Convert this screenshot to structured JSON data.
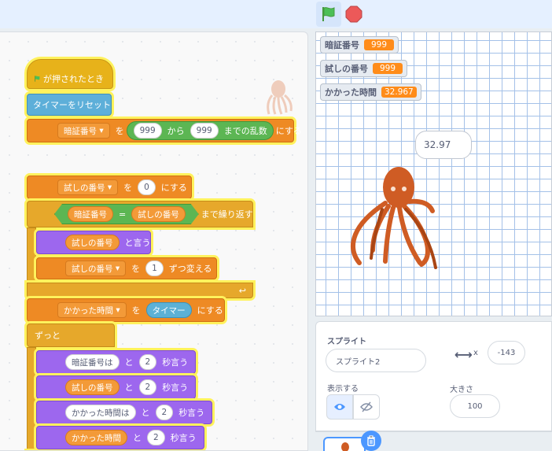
{
  "toolbar": {
    "flag_icon": "green-flag-icon",
    "stop_icon": "stop-icon"
  },
  "script": {
    "hat_label": "が押されたとき",
    "reset_timer": "タイマーをリセット",
    "set_pin": {
      "var": "暗証番号",
      "to": "を",
      "from_val": "999",
      "kara": "から",
      "to_val": "999",
      "rand": "までの乱数",
      "suru": "にする"
    },
    "set_try": {
      "var": "試しの番号",
      "to": "を",
      "val": "0",
      "suru": "にする"
    },
    "repeat_until": {
      "left": "暗証番号",
      "eq": "=",
      "right": "試しの番号",
      "label": "まで繰り返す"
    },
    "say_try": {
      "var": "試しの番号",
      "label": "と言う"
    },
    "change_try": {
      "var": "試しの番号",
      "to": "を",
      "val": "1",
      "label": "ずつ変える"
    },
    "set_elapsed": {
      "var": "かかった時間",
      "to": "を",
      "sensor": "タイマー",
      "suru": "にする"
    },
    "forever": "ずっと",
    "says": [
      {
        "text": "暗証番号は",
        "kind": "text",
        "to": "と",
        "secs": "2",
        "label": "秒言う"
      },
      {
        "text": "試しの番号",
        "kind": "var",
        "to": "と",
        "secs": "2",
        "label": "秒言う"
      },
      {
        "text": "かかった時間は",
        "kind": "text",
        "to": "と",
        "secs": "2",
        "label": "秒言う"
      },
      {
        "text": "かかった時間",
        "kind": "var",
        "to": "と",
        "secs": "2",
        "label": "秒言う"
      }
    ]
  },
  "stage": {
    "monitors": [
      {
        "label": "暗証番号",
        "value": "999"
      },
      {
        "label": "試しの番号",
        "value": "999"
      },
      {
        "label": "かかった時間",
        "value": "32.967"
      }
    ],
    "speech": "32.97"
  },
  "sprite_panel": {
    "sprite_label": "スプライト",
    "sprite_name": "スプライト2",
    "x_label": "x",
    "x_value": "-143",
    "show_label": "表示する",
    "size_label": "大きさ",
    "size_value": "100"
  }
}
